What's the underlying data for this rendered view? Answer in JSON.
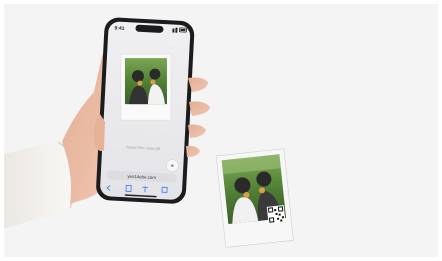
{
  "phone": {
    "status_time": "9:41",
    "viewer_caption": "Instant Film • Scan QR",
    "address_bar_url": "yes14ebe.com"
  },
  "colors": {
    "background": "#f4f4f4",
    "skin": "#e9b9a1",
    "sleeve": "#f3f1ee",
    "phone_body": "#1c1c1e",
    "screen_bg": "#ececef",
    "polaroid_frame": "#f7f7f7",
    "photo_green": "#5a8a3a"
  },
  "icons": [
    "back-icon",
    "share-icon",
    "bookmarks-icon",
    "tabs-icon",
    "hint-bubble-icon",
    "qr-code-icon"
  ]
}
